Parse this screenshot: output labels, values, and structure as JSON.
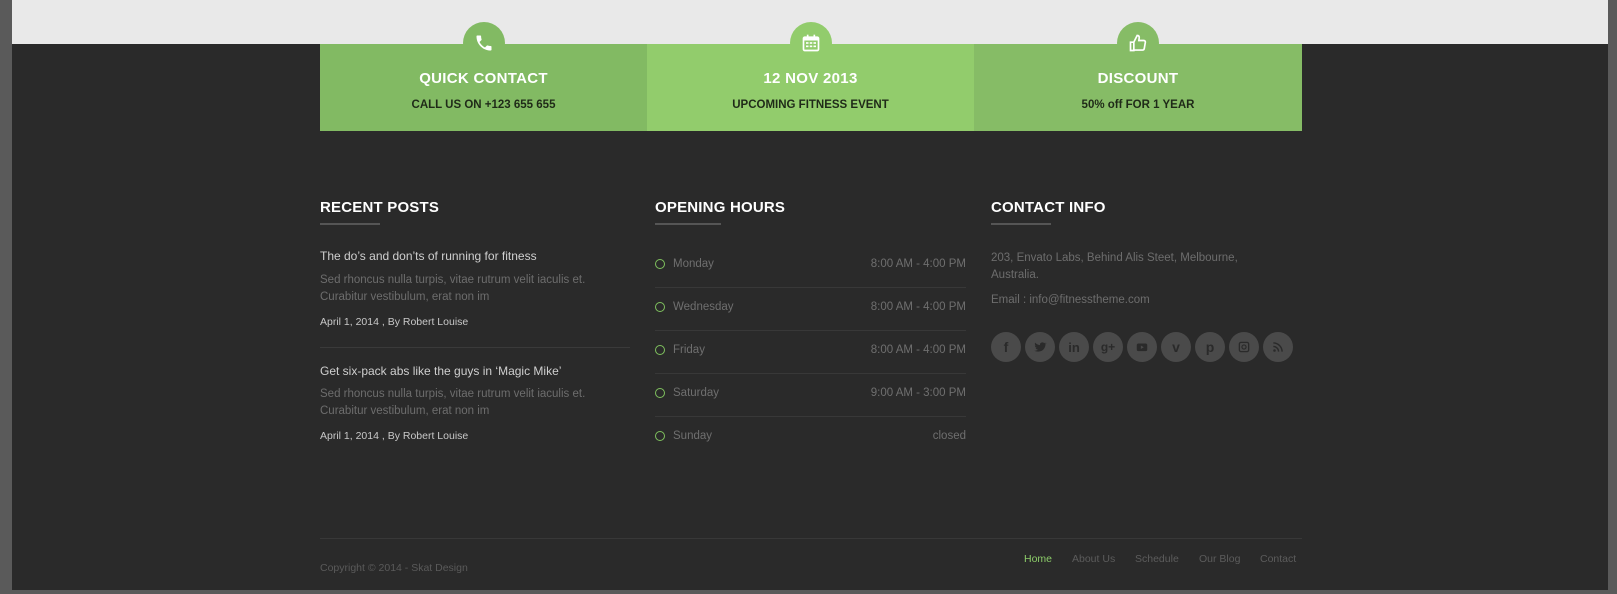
{
  "promo": [
    {
      "title": "QUICK CONTACT",
      "subtitle": "CALL US ON +123 655 655",
      "icon": "phone-icon",
      "color": "#82ba63"
    },
    {
      "title": "12 NOV 2013",
      "subtitle": "UPCOMING FITNESS EVENT",
      "icon": "calendar-icon",
      "color": "#92cc6c"
    },
    {
      "title": "DISCOUNT",
      "subtitle": "50% off FOR 1 YEAR",
      "icon": "thumbs-up-icon",
      "color": "#86bc66"
    }
  ],
  "recent_posts": {
    "heading": "RECENT POSTS",
    "posts": [
      {
        "title": "The do’s and don’ts of running for fitness",
        "excerpt": "Sed rhoncus nulla turpis, vitae rutrum velit iaculis et. Curabitur vestibulum, erat non im",
        "meta": "April 1, 2014 , By Robert Louise"
      },
      {
        "title": "Get six-pack abs like the guys in ‘Magic Mike’",
        "excerpt": "Sed rhoncus nulla turpis, vitae rutrum velit iaculis et. Curabitur vestibulum, erat non im",
        "meta": "April 1, 2014 , By Robert Louise"
      }
    ]
  },
  "opening_hours": {
    "heading": "OPENING HOURS",
    "rows": [
      {
        "day": "Monday",
        "time": "8:00 AM - 4:00 PM"
      },
      {
        "day": "Wednesday",
        "time": "8:00 AM - 4:00 PM"
      },
      {
        "day": "Friday",
        "time": "8:00 AM - 4:00 PM"
      },
      {
        "day": "Saturday",
        "time": "9:00 AM - 3:00 PM"
      },
      {
        "day": "Sunday",
        "time": "closed"
      }
    ]
  },
  "contact_info": {
    "heading": "CONTACT INFO",
    "address": "203, Envato Labs, Behind Alis Steet, Melbourne, Australia.",
    "email": "Email : info@fitnesstheme.com",
    "social": [
      "facebook-icon",
      "twitter-icon",
      "linkedin-icon",
      "google-plus-icon",
      "youtube-icon",
      "vimeo-icon",
      "pinterest-icon",
      "instagram-icon",
      "rss-icon"
    ]
  },
  "footer": {
    "copyright": "Copyright © 2014 - Skat Design",
    "nav": [
      "Home",
      "About Us",
      "Schedule",
      "Our Blog",
      "Contact"
    ],
    "active": "Home"
  },
  "colors": {
    "accent": "#8ccc69",
    "background": "#2a2a2a",
    "topband": "#e9e9e9"
  }
}
